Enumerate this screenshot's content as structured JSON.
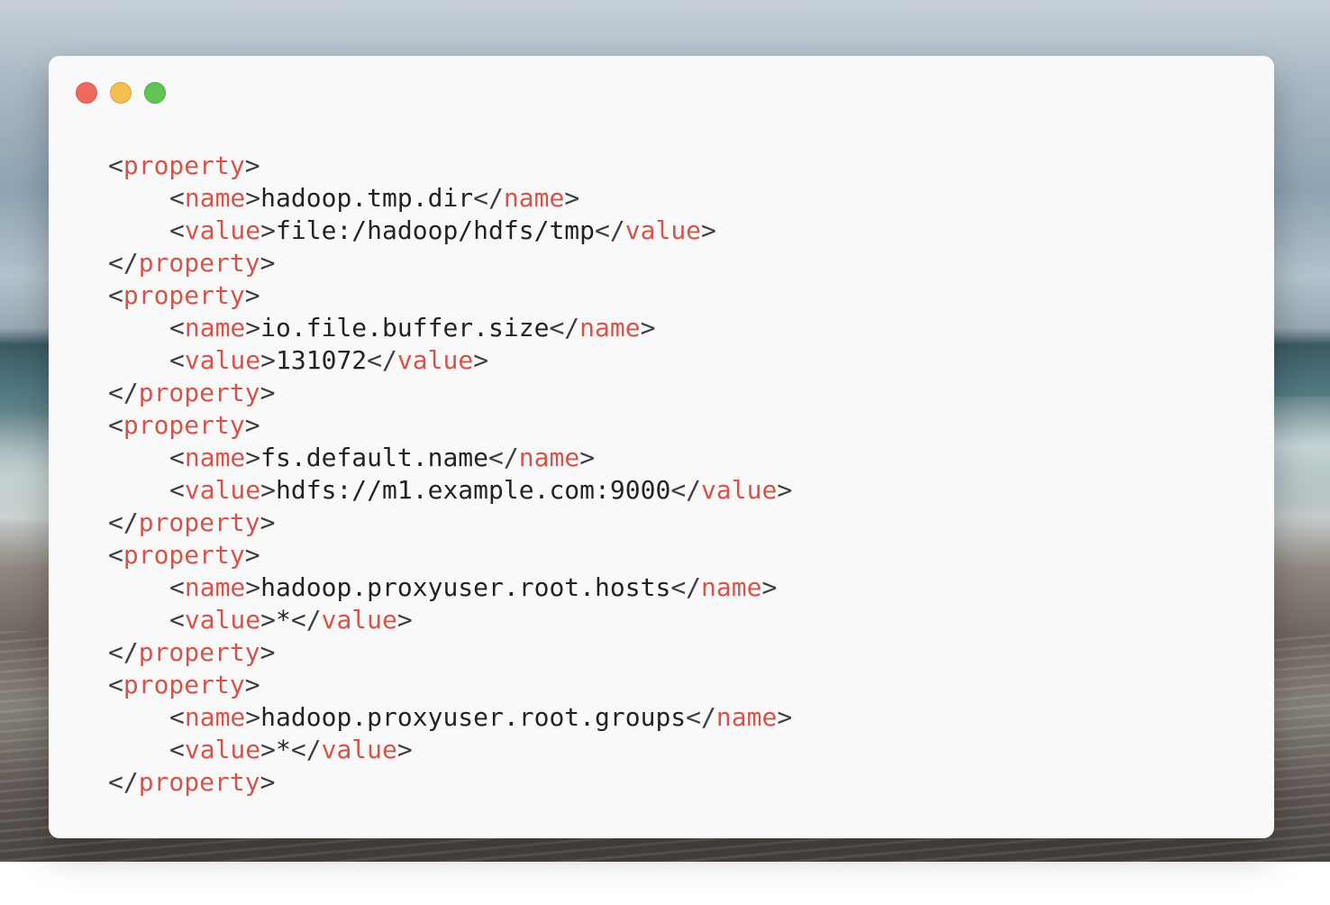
{
  "window": {
    "controls": [
      "close",
      "minimize",
      "zoom"
    ],
    "colors": {
      "close": "#ee6a5f",
      "minimize": "#f5bf4f",
      "zoom": "#61c454"
    }
  },
  "syntax_colors": {
    "tag": "#d4544a",
    "text": "#1f2328",
    "punctuation": "#3a3f44"
  },
  "properties": [
    {
      "name": "hadoop.tmp.dir",
      "value": "file:/hadoop/hdfs/tmp"
    },
    {
      "name": "io.file.buffer.size",
      "value": "131072"
    },
    {
      "name": "fs.default.name",
      "value": "hdfs://m1.example.com:9000"
    },
    {
      "name": "hadoop.proxyuser.root.hosts",
      "value": "*"
    },
    {
      "name": "hadoop.proxyuser.root.groups",
      "value": "*"
    }
  ],
  "tags": {
    "property": "property",
    "name": "name",
    "value": "value"
  }
}
